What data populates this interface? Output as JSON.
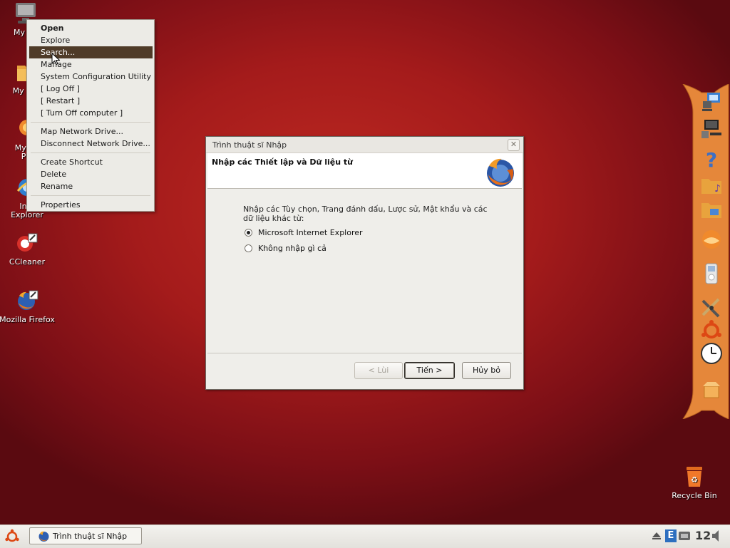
{
  "desktop": {
    "icons": [
      {
        "label": "My Co",
        "icon": "computer-icon"
      },
      {
        "label": "My Doc",
        "icon": "documents-icon"
      },
      {
        "label": "My Ne",
        "label2": "Pla",
        "icon": "network-places-icon"
      },
      {
        "label": "Inte",
        "label2": "Explorer",
        "icon": "internet-explorer-icon"
      },
      {
        "label": "CCleaner",
        "icon": "ccleaner-icon"
      },
      {
        "label": "Mozilla Firefox",
        "icon": "firefox-icon"
      },
      {
        "label": "Recycle Bin",
        "icon": "recycle-bin-icon"
      }
    ]
  },
  "context_menu": {
    "items": [
      {
        "label": "Open",
        "bold": true
      },
      {
        "label": "Explore"
      },
      {
        "label": "Search...",
        "highlighted": true
      },
      {
        "label": "Manage"
      },
      {
        "label": "System Configuration Utility"
      },
      {
        "label": "[ Log Off ]"
      },
      {
        "label": "[ Restart ]"
      },
      {
        "label": "[ Turn Off computer ]"
      },
      {
        "label": "Map Network Drive..."
      },
      {
        "label": "Disconnect Network Drive..."
      },
      {
        "label": "Create Shortcut"
      },
      {
        "label": "Delete"
      },
      {
        "label": "Rename"
      },
      {
        "label": "Properties"
      }
    ]
  },
  "dialog": {
    "title": "Trình thuật sĩ Nhập",
    "close_glyph": "✕",
    "header_title": "Nhập các Thiết lập và Dữ liệu từ",
    "prompt": "Nhập các Tùy chọn, Trang đánh dấu, Lược sử, Mật khẩu và các dữ liệu khác từ:",
    "options": [
      {
        "label": "Microsoft Internet Explorer",
        "selected": true
      },
      {
        "label": "Không nhập gì cả",
        "selected": false
      }
    ],
    "buttons": {
      "back": "< Lùi",
      "next": "Tiến >",
      "cancel": "Hủy bỏ"
    }
  },
  "taskbar": {
    "start_icon": "ubuntu-logo-icon",
    "task_label": "Trình thuật sĩ Nhập",
    "clock_text": "12"
  },
  "colors": {
    "accent_highlight": "#4f3b28",
    "desktop_red": "#a41b1b",
    "dock_orange": "#e5873a"
  }
}
